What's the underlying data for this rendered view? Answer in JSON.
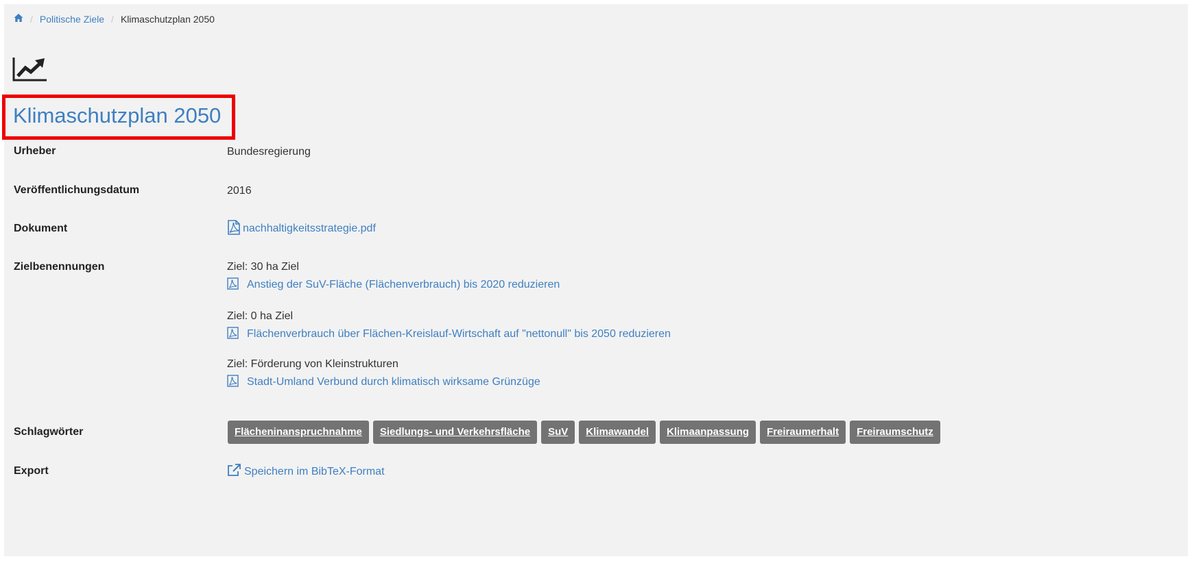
{
  "breadcrumb": {
    "home_icon": "home-icon",
    "items": [
      "Politische Ziele",
      "Klimaschutzplan 2050"
    ]
  },
  "page": {
    "icon": "line-chart-icon",
    "title": "Klimaschutzplan 2050"
  },
  "fields": {
    "urheber": {
      "label": "Urheber",
      "value": "Bundesregierung"
    },
    "datum": {
      "label": "Veröffentlichungsdatum",
      "value": "2016"
    },
    "dokument": {
      "label": "Dokument",
      "value": "nachhaltigkeitsstrategie.pdf",
      "icon": "pdf-file-icon"
    },
    "zielbenennungen": {
      "label": "Zielbenennungen",
      "items": [
        {
          "title": "Ziel: 30 ha Ziel",
          "link": "Anstieg der SuV-Fläche (Flächenverbrauch) bis 2020 reduzieren"
        },
        {
          "title": "Ziel: 0 ha Ziel",
          "link": "Flächenverbrauch über Flächen-Kreislauf-Wirtschaft auf \"nettonull\" bis 2050 reduzieren"
        },
        {
          "title": "Ziel: Förderung von Kleinstrukturen",
          "link": "Stadt-Umland Verbund durch klimatisch wirksame Grünzüge"
        }
      ]
    },
    "schlagwoerter": {
      "label": "Schlagwörter",
      "tags": [
        "Flächeninanspruchnahme",
        "Siedlungs- und Verkehrsfläche",
        "SuV",
        "Klimawandel",
        "Klimaanpassung",
        "Freiraumerhalt",
        "Freiraumschutz"
      ]
    },
    "export": {
      "label": "Export",
      "value": "Speichern im BibTeX-Format",
      "icon": "external-link-icon"
    }
  },
  "colors": {
    "link": "#3f7fc1",
    "tag_bg": "#737373",
    "highlight_border": "#ee0000",
    "panel_bg": "#f2f2f2"
  }
}
